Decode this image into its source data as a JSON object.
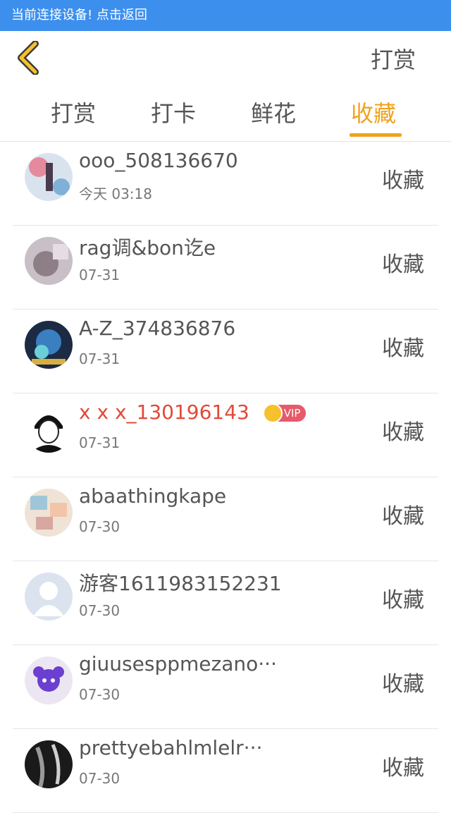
{
  "status_bar": {
    "text": "当前连接设备! 点击返回"
  },
  "header": {
    "title": "打赏"
  },
  "tabs": [
    {
      "label": "打赏",
      "active": false
    },
    {
      "label": "打卡",
      "active": false
    },
    {
      "label": "鲜花",
      "active": false
    },
    {
      "label": "收藏",
      "active": true
    }
  ],
  "colors": {
    "status_bar": "#3d8fee",
    "accent": "#f0a21e",
    "vip_name": "#e04a38"
  },
  "rows": [
    {
      "name": "ooo_508136670",
      "time": "今天 03:18",
      "action": "收藏"
    },
    {
      "name": "rag调&bon讫e",
      "time": "07-31",
      "action": "收藏"
    },
    {
      "name": "A-Z_374836876",
      "time": "07-31",
      "action": "收藏"
    },
    {
      "name": "x x x_130196143",
      "time": "07-31",
      "action": "收藏",
      "vip": "VIP"
    },
    {
      "name": "abaathingkape",
      "time": "07-30",
      "action": "收藏"
    },
    {
      "name": "游客1611983152231",
      "time": "07-30",
      "action": "收藏"
    },
    {
      "name": "giuusesppmezano···",
      "time": "07-30",
      "action": "收藏"
    },
    {
      "name": "prettyebahlmlelr···",
      "time": "07-30",
      "action": "收藏"
    }
  ]
}
